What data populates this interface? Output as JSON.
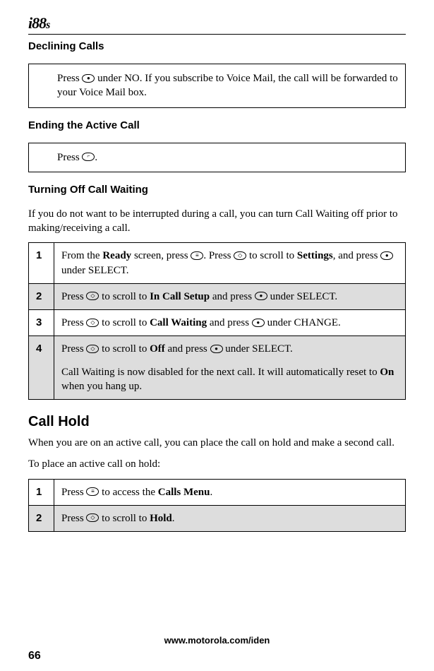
{
  "header": {
    "logo_main": "i88",
    "logo_suffix": "s"
  },
  "sections": {
    "declining": {
      "title": "Declining Calls",
      "step_text_a": "Press ",
      "step_text_b": " under NO. If you subscribe to Voice Mail, the call will be forwarded to your Voice Mail box."
    },
    "ending": {
      "title": "Ending the Active Call",
      "step_text_a": "Press ",
      "step_text_b": "."
    },
    "turning_off": {
      "title": "Turning Off Call Waiting",
      "intro": "If you do not want to be interrupted during a call, you can turn Call Waiting off prior to making/receiving a call.",
      "steps": [
        {
          "num": "1",
          "t1": "From the ",
          "b1": "Ready",
          "t2": " screen, press ",
          "t3": ". Press ",
          "t4": " to scroll to ",
          "b2": "Settings",
          "t5": ", and press ",
          "t6": " under SELECT."
        },
        {
          "num": "2",
          "t1": "Press ",
          "t2": " to scroll to ",
          "b1": "In Call Setup",
          "t3": " and press ",
          "t4": " under SELECT."
        },
        {
          "num": "3",
          "t1": "Press ",
          "t2": " to scroll to ",
          "b1": "Call Waiting",
          "t3": " and press ",
          "t4": " under CHANGE."
        },
        {
          "num": "4",
          "t1": "Press ",
          "t2": " to scroll to ",
          "b1": "Off",
          "t3": " and press ",
          "t4": " under SELECT.",
          "para2a": "Call Waiting is now disabled for the next call. It will automatically reset to ",
          "para2b": "On",
          "para2c": " when you hang up."
        }
      ]
    },
    "call_hold": {
      "title": "Call Hold",
      "intro1": "When you are on an active call, you can place the call on hold and make a second call.",
      "intro2": "To place an active call on hold:",
      "steps": [
        {
          "num": "1",
          "t1": "Press ",
          "t2": " to access the ",
          "b1": "Calls Menu",
          "t3": "."
        },
        {
          "num": "2",
          "t1": "Press ",
          "t2": " to scroll to ",
          "b1": "Hold",
          "t3": "."
        }
      ]
    }
  },
  "icons": {
    "soft_under": "●",
    "end_key": "⌐",
    "menu_key": "≡",
    "scroll_key": "◇"
  },
  "footer": {
    "url": "www.motorola.com/iden",
    "page": "66"
  }
}
